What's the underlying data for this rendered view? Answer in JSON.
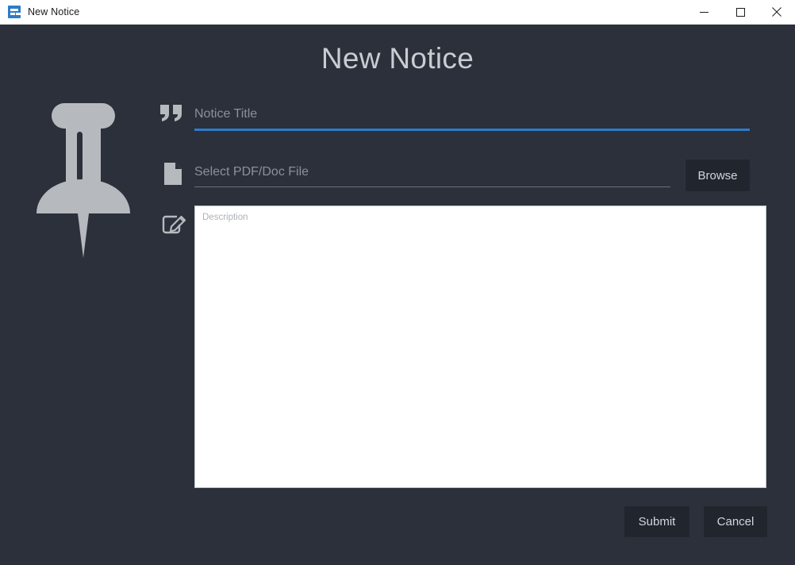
{
  "window": {
    "title": "New Notice",
    "app_icon": "notice-app-icon",
    "controls": {
      "minimize": "minimize-icon",
      "maximize": "maximize-icon",
      "close": "close-icon"
    }
  },
  "header": {
    "title": "New Notice"
  },
  "illustration": {
    "name": "pushpin-icon",
    "color": "#b6b9be"
  },
  "form": {
    "title_field": {
      "icon": "quote-icon",
      "placeholder": "Notice Title",
      "value": "",
      "underline_color": "#2d7cc9",
      "focused": true
    },
    "file_field": {
      "icon": "document-icon",
      "placeholder": "Select PDF/Doc File",
      "value": "",
      "underline_color": "#6b707a",
      "browse_label": "Browse"
    },
    "description_field": {
      "icon": "edit-pencil-icon",
      "placeholder": "Description",
      "value": ""
    }
  },
  "actions": {
    "submit_label": "Submit",
    "cancel_label": "Cancel"
  },
  "colors": {
    "background": "#2b303b",
    "button_background": "#21252d",
    "accent_blue": "#2d7cc9",
    "text_light": "#d3d6da",
    "placeholder": "#8c9099"
  }
}
